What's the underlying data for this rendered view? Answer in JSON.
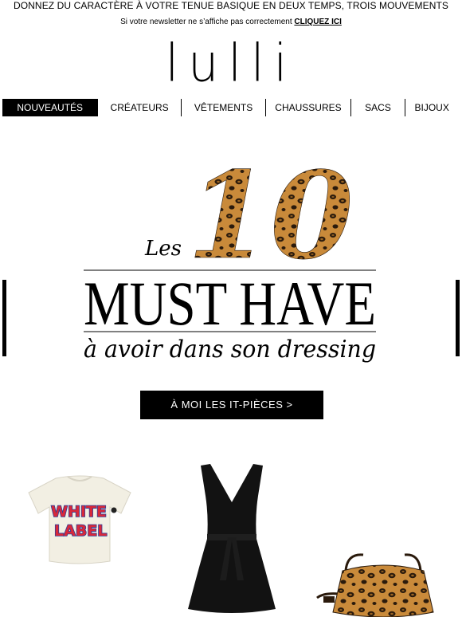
{
  "promo_bar": {
    "text": "DONNEZ DU CARACTÈRE À VOTRE TENUE BASIQUE EN DEUX TEMPS, TROIS MOUVEMENTS"
  },
  "newsletter_notice": {
    "text": "Si votre newsletter ne s’affiche pas correctement",
    "link": "CLIQUEZ ICI"
  },
  "logo": {
    "text": "lulli"
  },
  "nav": {
    "items": [
      {
        "label": "NOUVEAUTÉS"
      },
      {
        "label": "CRÉATEURS"
      },
      {
        "label": "VÊTEMENTS"
      },
      {
        "label": "CHAUSSURES"
      },
      {
        "label": "SACS"
      },
      {
        "label": "BIJOUX"
      }
    ]
  },
  "hero": {
    "prefix": "Les",
    "number": "10",
    "title": "MUST HAVE",
    "subtitle": "à avoir dans son dressing"
  },
  "cta": {
    "label": "À MOI LES IT-PIÈCES >"
  },
  "products": {
    "tshirt": {
      "print_line1": "WHITE",
      "print_line2": "LABEL"
    }
  },
  "colors": {
    "accent": "#000000",
    "leopard_base": "#c98a3a",
    "leopard_spot": "#2a1a0c"
  }
}
